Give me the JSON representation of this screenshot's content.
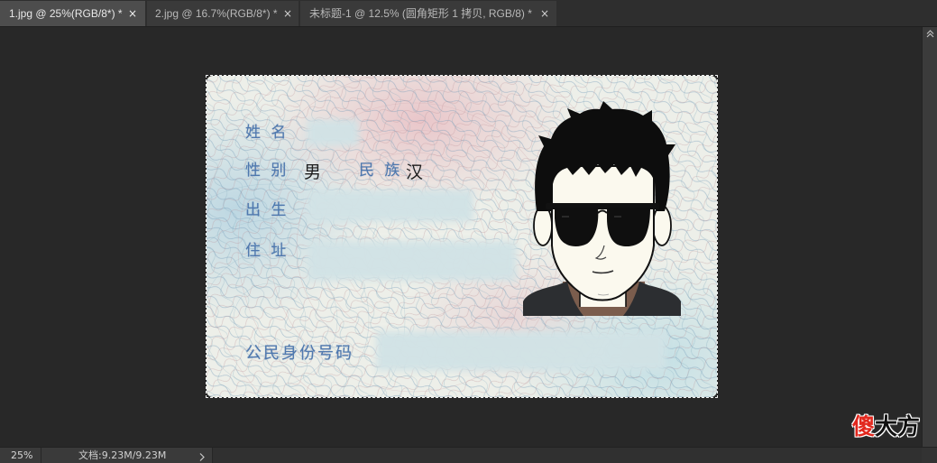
{
  "app": {
    "tabs": [
      {
        "label": "1.jpg @ 25%(RGB/8*) *",
        "close": "×",
        "active": true
      },
      {
        "label": "2.jpg @ 16.7%(RGB/8*) *",
        "close": "×",
        "active": false
      },
      {
        "label": "未标题-1 @ 12.5% (圆角矩形 1 拷贝, RGB/8) *",
        "close": "×",
        "active": false
      }
    ],
    "panel_toggle_icon": "double-chevron-icon"
  },
  "document": {
    "id_card": {
      "labels": {
        "name": "姓 名",
        "gender": "性 别",
        "ethnicity": "民 族",
        "birth": "出 生",
        "address": "住 址",
        "id_number": "公民身份号码"
      },
      "values": {
        "gender": "男",
        "ethnicity": "汉"
      }
    }
  },
  "status_bar": {
    "zoom": "25%",
    "doc_info": "文档:9.23M/9.23M",
    "menu_icon": "chevron-right-icon"
  },
  "watermark": {
    "first": "傻",
    "rest": "大方"
  },
  "colors": {
    "canvas": "#282828",
    "active_tab": "#4d4d4d",
    "label_blue": "#4f78ae",
    "watermark_red": "#e2271d"
  }
}
